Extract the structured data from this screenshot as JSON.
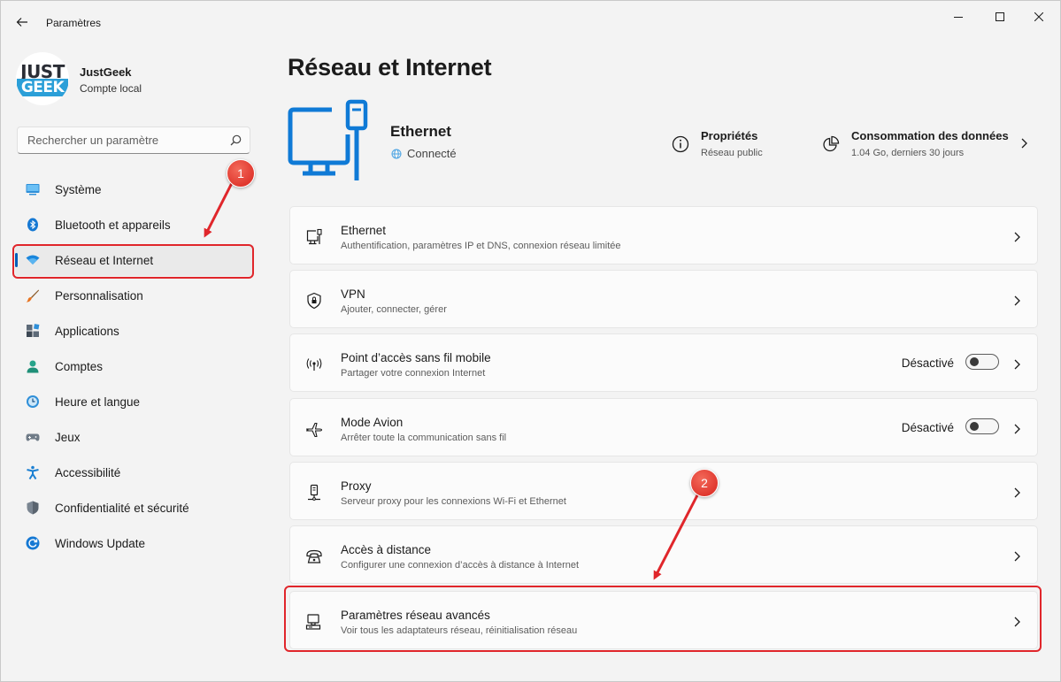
{
  "window": {
    "title": "Paramètres"
  },
  "profile": {
    "logo_top": "JUST",
    "logo_bottom": "GEEK",
    "name": "JustGeek",
    "account": "Compte local"
  },
  "search": {
    "placeholder": "Rechercher un paramètre"
  },
  "sidebar": {
    "items": [
      {
        "label": "Système",
        "icon": "monitor-icon"
      },
      {
        "label": "Bluetooth et appareils",
        "icon": "bluetooth-icon"
      },
      {
        "label": "Réseau et Internet",
        "icon": "wifi-icon",
        "active": true
      },
      {
        "label": "Personnalisation",
        "icon": "brush-icon"
      },
      {
        "label": "Applications",
        "icon": "apps-icon"
      },
      {
        "label": "Comptes",
        "icon": "person-icon"
      },
      {
        "label": "Heure et langue",
        "icon": "clock-globe-icon"
      },
      {
        "label": "Jeux",
        "icon": "gamepad-icon"
      },
      {
        "label": "Accessibilité",
        "icon": "accessibility-icon"
      },
      {
        "label": "Confidentialité et sécurité",
        "icon": "shield-icon"
      },
      {
        "label": "Windows Update",
        "icon": "update-icon"
      }
    ]
  },
  "header": {
    "title": "Réseau et Internet",
    "connection_name": "Ethernet",
    "connection_status": "Connecté",
    "properties_title": "Propriétés",
    "properties_sub": "Réseau public",
    "usage_title": "Consommation des données",
    "usage_sub": "1.04 Go, derniers 30 jours"
  },
  "cards": [
    {
      "title": "Ethernet",
      "sub": "Authentification, paramètres IP et DNS, connexion réseau limitée",
      "icon": "ethernet-icon"
    },
    {
      "title": "VPN",
      "sub": "Ajouter, connecter, gérer",
      "icon": "vpn-shield-icon"
    },
    {
      "title": "Point d’accès sans fil mobile",
      "sub": "Partager votre connexion Internet",
      "icon": "hotspot-icon",
      "toggle": "Désactivé"
    },
    {
      "title": "Mode Avion",
      "sub": "Arrêter toute la communication sans fil",
      "icon": "airplane-icon",
      "toggle": "Désactivé"
    },
    {
      "title": "Proxy",
      "sub": "Serveur proxy pour les connexions Wi-Fi et Ethernet",
      "icon": "proxy-icon"
    },
    {
      "title": "Accès à distance",
      "sub": "Configurer une connexion d’accès à distance à Internet",
      "icon": "dialup-icon"
    },
    {
      "title": "Paramètres réseau avancés",
      "sub": "Voir tous les adaptateurs réseau, réinitialisation réseau",
      "icon": "network-adapter-icon"
    }
  ],
  "annotations": {
    "badge1": "1",
    "badge2": "2",
    "color": "#e0262b"
  },
  "colors": {
    "accent": "#005fb8",
    "hero_blue": "#0f7ad6"
  }
}
